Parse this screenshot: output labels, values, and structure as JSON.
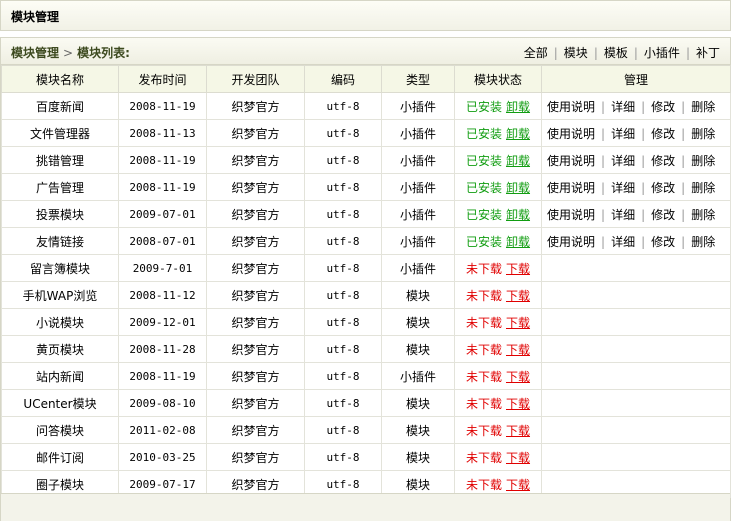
{
  "page_title": "模块管理",
  "breadcrumb": {
    "root": "模块管理",
    "arrow": ">",
    "current": "模块列表:"
  },
  "filters": [
    "全部",
    "模块",
    "模板",
    "小插件",
    "补丁"
  ],
  "columns": [
    "模块名称",
    "发布时间",
    "开发团队",
    "编码",
    "类型",
    "模块状态",
    "管理"
  ],
  "actions": [
    "使用说明",
    "详细",
    "修改",
    "删除"
  ],
  "status_labels": {
    "installed": "已安装",
    "uninstall": "卸载",
    "not_downloaded": "未下载",
    "download": "下载"
  },
  "rows": [
    {
      "name": "百度新闻",
      "date": "2008-11-19",
      "team": "织梦官方",
      "encoding": "utf-8",
      "type": "小插件",
      "installed": true
    },
    {
      "name": "文件管理器",
      "date": "2008-11-13",
      "team": "织梦官方",
      "encoding": "utf-8",
      "type": "小插件",
      "installed": true
    },
    {
      "name": "挑错管理",
      "date": "2008-11-19",
      "team": "织梦官方",
      "encoding": "utf-8",
      "type": "小插件",
      "installed": true
    },
    {
      "name": "广告管理",
      "date": "2008-11-19",
      "team": "织梦官方",
      "encoding": "utf-8",
      "type": "小插件",
      "installed": true
    },
    {
      "name": "投票模块",
      "date": "2009-07-01",
      "team": "织梦官方",
      "encoding": "utf-8",
      "type": "小插件",
      "installed": true
    },
    {
      "name": "友情链接",
      "date": "2008-07-01",
      "team": "织梦官方",
      "encoding": "utf-8",
      "type": "小插件",
      "installed": true
    },
    {
      "name": "留言簿模块",
      "date": "2009-7-01",
      "team": "织梦官方",
      "encoding": "utf-8",
      "type": "小插件",
      "installed": false
    },
    {
      "name": "手机WAP浏览",
      "date": "2008-11-12",
      "team": "织梦官方",
      "encoding": "utf-8",
      "type": "模块",
      "installed": false
    },
    {
      "name": "小说模块",
      "date": "2009-12-01",
      "team": "织梦官方",
      "encoding": "utf-8",
      "type": "模块",
      "installed": false
    },
    {
      "name": "黄页模块",
      "date": "2008-11-28",
      "team": "织梦官方",
      "encoding": "utf-8",
      "type": "模块",
      "installed": false
    },
    {
      "name": "站内新闻",
      "date": "2008-11-19",
      "team": "织梦官方",
      "encoding": "utf-8",
      "type": "小插件",
      "installed": false
    },
    {
      "name": "UCenter模块",
      "date": "2009-08-10",
      "team": "织梦官方",
      "encoding": "utf-8",
      "type": "模块",
      "installed": false
    },
    {
      "name": "问答模块",
      "date": "2011-02-08",
      "team": "织梦官方",
      "encoding": "utf-8",
      "type": "模块",
      "installed": false
    },
    {
      "name": "邮件订阅",
      "date": "2010-03-25",
      "team": "织梦官方",
      "encoding": "utf-8",
      "type": "模块",
      "installed": false
    },
    {
      "name": "圈子模块",
      "date": "2009-07-17",
      "team": "织梦官方",
      "encoding": "utf-8",
      "type": "模块",
      "installed": false
    }
  ]
}
